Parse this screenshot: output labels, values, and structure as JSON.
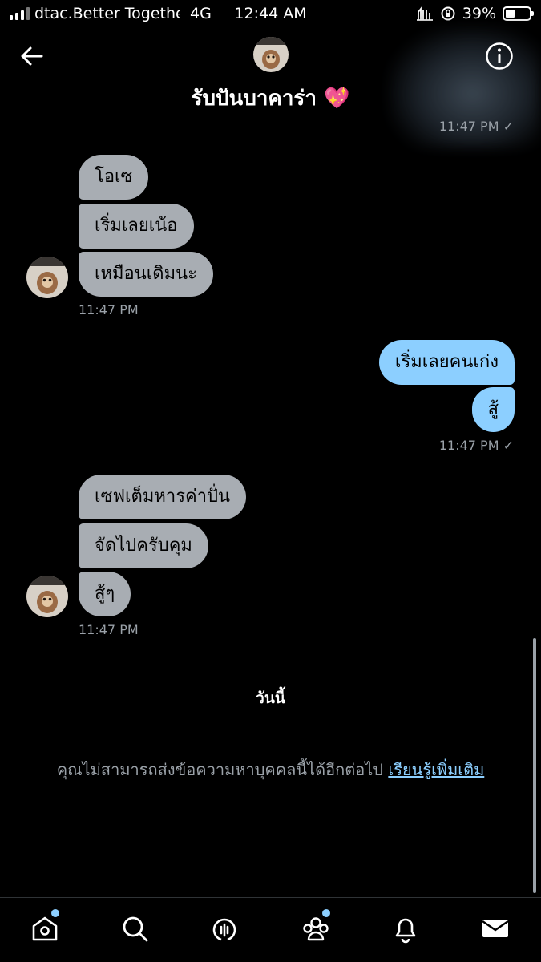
{
  "status_bar": {
    "carrier": "dtac.Better Togethe",
    "network": "4G",
    "time": "12:44 AM",
    "battery": "39%",
    "battery_level": 0.39
  },
  "header": {
    "title": "รับปันบาคาร่า 💖"
  },
  "messages": {
    "top_time": "11:47 PM ✓",
    "group1": [
      "โอเซ",
      "เริ่มเลยเน้อ",
      "เหมือนเดิมนะ"
    ],
    "group1_time": "11:47 PM",
    "group2": [
      "เริ่มเลยคนเก่ง",
      "สู้"
    ],
    "group2_time": "11:47 PM ✓",
    "group3": [
      "เซฟเต็มหารค่าปั่น",
      "จัดไปครับคุม",
      "สู้ๆ"
    ],
    "group3_time": "11:47 PM"
  },
  "day_label": "วันนี้",
  "notice": {
    "text": "คุณไม่สามารถส่งข้อความหาบุคคลนี้ได้อีกต่อไป",
    "link": "เรียนรู้เพิ่มเติม"
  },
  "colors": {
    "incoming_bubble": "#a8adb3",
    "outgoing_bubble": "#8ccfff",
    "accent": "#8ccfff",
    "muted_text": "#9aa1a8"
  },
  "icons": {
    "back": "arrow-left-icon",
    "info": "info-icon",
    "nav": [
      "home-icon",
      "search-icon",
      "spaces-icon",
      "communities-icon",
      "bell-icon",
      "mail-icon"
    ]
  }
}
